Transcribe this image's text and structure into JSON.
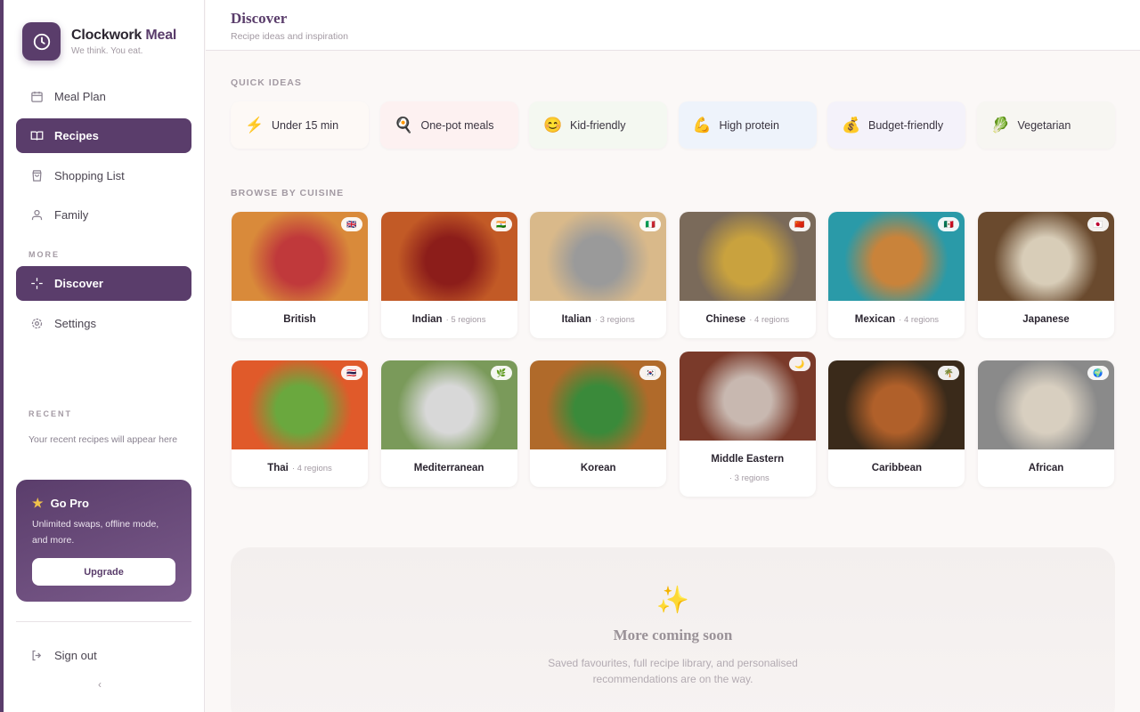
{
  "app": {
    "name_main": "Clockwork ",
    "name_accent": "Meal",
    "tagline": "We think. You eat.",
    "accent_color": "#5a3d6b"
  },
  "sidebar": {
    "nav": [
      {
        "label": "Meal Plan",
        "icon": "calendar-icon"
      },
      {
        "label": "Recipes",
        "icon": "book-icon",
        "active": true
      },
      {
        "label": "Shopping List",
        "icon": "shopping-bag-icon"
      },
      {
        "label": "Family",
        "icon": "family-icon"
      }
    ],
    "more_label": "MORE",
    "more": [
      {
        "label": "Discover",
        "icon": "sparkle-icon",
        "active": true
      },
      {
        "label": "Settings",
        "icon": "gear-icon"
      }
    ],
    "recent_label": "RECENT",
    "recent_note": "Your recent recipes will appear here",
    "pro": {
      "title": "Go Pro",
      "description": "Unlimited swaps, offline mode, and more.",
      "button": "Upgrade"
    },
    "sign_out": "Sign out",
    "collapse": "‹"
  },
  "header": {
    "title": "Discover",
    "subtitle": "Recipe ideas and inspiration"
  },
  "quick_ideas": {
    "label": "QUICK IDEAS",
    "items": [
      {
        "label": "Under 15 min",
        "icon": "⚡",
        "bg": "#fdf9f6"
      },
      {
        "label": "One-pot meals",
        "icon": "🍳",
        "bg": "#fdf1f1"
      },
      {
        "label": "Kid-friendly",
        "icon": "😊",
        "bg": "#f4f8f1"
      },
      {
        "label": "High protein",
        "icon": "💪",
        "bg": "#eef3fb"
      },
      {
        "label": "Budget-friendly",
        "icon": "💰",
        "bg": "#f4f2fa"
      },
      {
        "label": "Vegetarian",
        "icon": "🥬",
        "bg": "#f7f6f2"
      }
    ]
  },
  "cuisines": {
    "label": "BROWSE BY CUISINE",
    "items": [
      {
        "name": "British",
        "regions": "",
        "flag": "🇬🇧",
        "c1": "#d98a3a",
        "c2": "#c0393b"
      },
      {
        "name": "Indian",
        "regions": "· 5 regions",
        "flag": "🇮🇳",
        "c1": "#c25a26",
        "c2": "#8c1d1a"
      },
      {
        "name": "Italian",
        "regions": "· 3 regions",
        "flag": "🇮🇹",
        "c1": "#d9b98a",
        "c2": "#9a9a9a"
      },
      {
        "name": "Chinese",
        "regions": "· 4 regions",
        "flag": "🇨🇳",
        "c1": "#7a6a5a",
        "c2": "#c9a23e"
      },
      {
        "name": "Mexican",
        "regions": "· 4 regions",
        "flag": "🇲🇽",
        "c1": "#2a9aa8",
        "c2": "#c9833a"
      },
      {
        "name": "Japanese",
        "regions": "",
        "flag": "🇯🇵",
        "c1": "#6a4a2e",
        "c2": "#d8cdb8"
      },
      {
        "name": "Thai",
        "regions": "· 4 regions",
        "flag": "🇹🇭",
        "c1": "#e05a2a",
        "c2": "#6aa83e"
      },
      {
        "name": "Mediterranean",
        "regions": "",
        "flag": "🌿",
        "c1": "#7a9a5a",
        "c2": "#d8d8d8"
      },
      {
        "name": "Korean",
        "regions": "",
        "flag": "🇰🇷",
        "c1": "#b06a2a",
        "c2": "#3a8a3a"
      },
      {
        "name": "Middle Eastern",
        "regions": "· 3 regions",
        "flag": "🌙",
        "c1": "#7a3a2a",
        "c2": "#c8b8b0"
      },
      {
        "name": "Caribbean",
        "regions": "",
        "flag": "🌴",
        "c1": "#3a2a1a",
        "c2": "#b0602a"
      },
      {
        "name": "African",
        "regions": "",
        "flag": "🌍",
        "c1": "#8a8a8a",
        "c2": "#d8cfc0"
      }
    ]
  },
  "coming_soon": {
    "icon": "✨",
    "title": "More coming soon",
    "description": "Saved favourites, full recipe library, and personalised recommendations are on the way."
  }
}
